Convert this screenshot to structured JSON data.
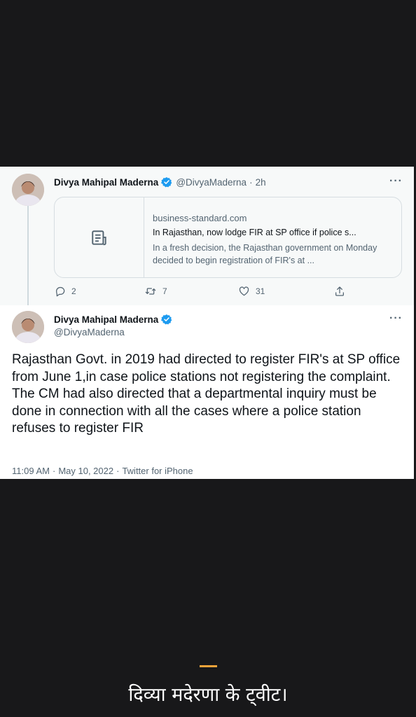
{
  "parent_tweet": {
    "display_name": "Divya Mahipal Maderna",
    "handle": "@DivyaMaderna",
    "time": "2h",
    "more_icon": "more-horizontal-icon",
    "link_card": {
      "domain": "business-standard.com",
      "title": "In Rajasthan, now lodge FIR at SP office if police s...",
      "description": "In a fresh decision, the Rajasthan government on Monday decided to begin registration of FIR's at ..."
    },
    "actions": {
      "replies": "2",
      "retweets": "7",
      "likes": "31"
    }
  },
  "main_tweet": {
    "display_name": "Divya Mahipal Maderna",
    "handle": "@DivyaMaderna",
    "body": "Rajasthan Govt. in 2019 had directed to register FIR's at SP office from June 1,in case police stations not registering the complaint.\nThe CM had also directed that a departmental inquiry must be done in connection with all the cases where a police station refuses to register FIR",
    "time": "11:09 AM",
    "date": "May 10, 2022",
    "source": "Twitter for iPhone"
  },
  "caption": "दिव्या मदेरणा के ट्वीट।",
  "colors": {
    "background": "#18181a",
    "verified": "#1d9bf0",
    "accent": "#f2a33a"
  }
}
